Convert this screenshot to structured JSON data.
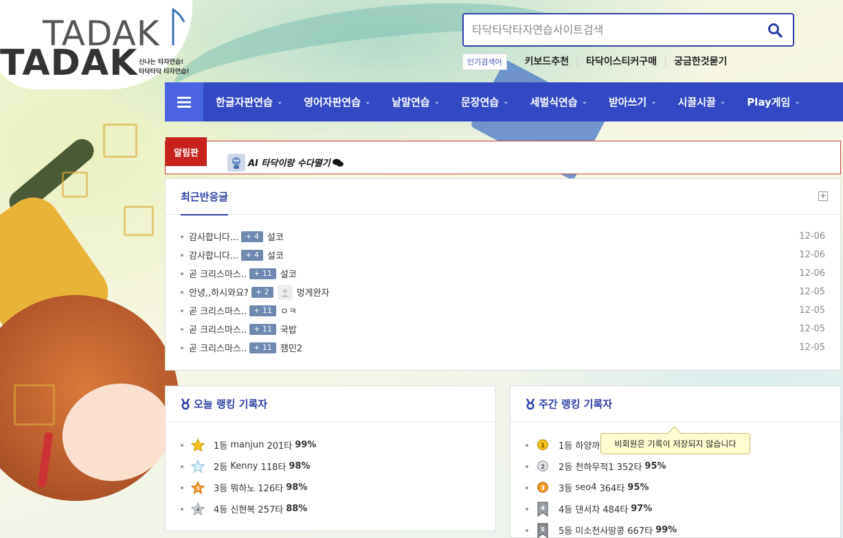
{
  "logo": {
    "top_text": "TADAK",
    "bottom_text": "TADAK",
    "tagline_1": "신나는 타자연습!",
    "tagline_2": "타닥타닥 타자연습!"
  },
  "search": {
    "placeholder": "타닥타닥타자연습사이트검색",
    "value": "",
    "icon": "search-icon"
  },
  "popular": {
    "label": "인기검색어",
    "links": [
      "키보드추천",
      "타닥이스티커구매",
      "궁금한것묻기"
    ]
  },
  "nav": {
    "menu_icon": "hamburger-icon",
    "items": [
      "한글자판연습",
      "영어자판연습",
      "낱말연습",
      "문장연습",
      "세벌식연습",
      "받아쓰기",
      "시끌시끌",
      "Play게임"
    ]
  },
  "notice": {
    "label": "알림판",
    "text": "AI 타닥이랑 수다떨기",
    "icon": "chat-icon"
  },
  "recent": {
    "title": "최근반응글",
    "more_icon": "expand-icon",
    "rows": [
      {
        "title": "감사합니다...",
        "count": "+ 4",
        "user": "설코",
        "avatar": false,
        "date": "12-06"
      },
      {
        "title": "감사합니다...",
        "count": "+ 4",
        "user": "설코",
        "avatar": false,
        "date": "12-06"
      },
      {
        "title": "곧 크리스마스..",
        "count": "+ 11",
        "user": "설코",
        "avatar": false,
        "date": "12-06"
      },
      {
        "title": "안녕,,하시와요?",
        "count": "+ 2",
        "user": "멍게완자",
        "avatar": true,
        "date": "12-05"
      },
      {
        "title": "곧 크리스마스..",
        "count": "+ 11",
        "user": "ㅇㅋ",
        "avatar": false,
        "date": "12-05"
      },
      {
        "title": "곧 크리스마스..",
        "count": "+ 11",
        "user": "국밥",
        "avatar": false,
        "date": "12-05"
      },
      {
        "title": "곧 크리스마스..",
        "count": "+ 11",
        "user": "잼민2",
        "avatar": false,
        "date": "12-05"
      }
    ]
  },
  "today_rank": {
    "title": "오늘 랭킹 기록자",
    "icon": "medal-icon",
    "rows": [
      {
        "rank": "1등",
        "name": "manjun",
        "speed": "201타",
        "accuracy": "99%"
      },
      {
        "rank": "2등",
        "name": "Kenny",
        "speed": "118타",
        "accuracy": "98%"
      },
      {
        "rank": "3등",
        "name": "뭐하노",
        "speed": "126타",
        "accuracy": "98%"
      },
      {
        "rank": "4등",
        "name": "신현복",
        "speed": "257타",
        "accuracy": "88%"
      }
    ]
  },
  "weekly_rank": {
    "title": "주간 랭킹 기록자",
    "icon": "medal-icon",
    "tooltip": "비회원은 기록이 저장되지 않습니다",
    "rows": [
      {
        "rank": "1등",
        "name": "하양까",
        "speed": "",
        "accuracy": ""
      },
      {
        "rank": "2등",
        "name": "천하무적1",
        "speed": "352타",
        "accuracy": "95%"
      },
      {
        "rank": "3등",
        "name": "seo4",
        "speed": "364타",
        "accuracy": "95%"
      },
      {
        "rank": "4등",
        "name": "댄서차",
        "speed": "484타",
        "accuracy": "97%"
      },
      {
        "rank": "5등",
        "name": "미소천사땅콩",
        "speed": "667타",
        "accuracy": "99%"
      }
    ]
  },
  "colors": {
    "nav_bg": "#3348c2",
    "accent": "#2c3fa5",
    "notice_red": "#c4221b",
    "badge": "#6e88b0"
  }
}
